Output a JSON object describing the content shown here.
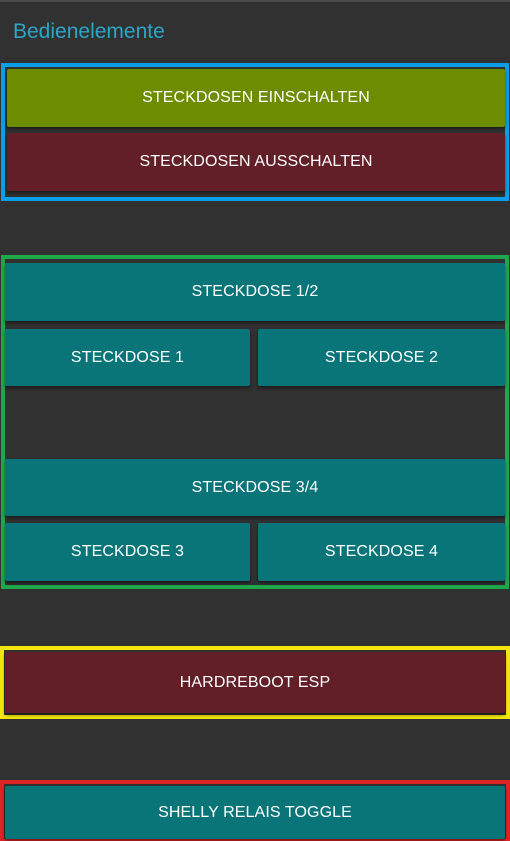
{
  "header": {
    "title": "Bedienelemente"
  },
  "groups": {
    "master": {
      "frame_color": "#0ba0e6",
      "on_label": "STECKDOSEN EINSCHALTEN",
      "on_color": "#6e8c00",
      "off_label": "STECKDOSEN AUSSCHALTEN",
      "off_color": "#621f27"
    },
    "sockets": {
      "frame_color": "#1fa84a",
      "button_color": "#0a7579",
      "pair_12_label": "STECKDOSE 1/2",
      "socket_1_label": "STECKDOSE 1",
      "socket_2_label": "STECKDOSE 2",
      "pair_34_label": "STECKDOSE 3/4",
      "socket_3_label": "STECKDOSE 3",
      "socket_4_label": "STECKDOSE 4"
    },
    "reboot": {
      "frame_color": "#f3e60c",
      "label": "HARDREBOOT ESP",
      "color": "#621f27"
    },
    "shelly": {
      "frame_color": "#dc2426",
      "label": "SHELLY RELAIS TOGGLE",
      "color": "#0a7579"
    }
  }
}
